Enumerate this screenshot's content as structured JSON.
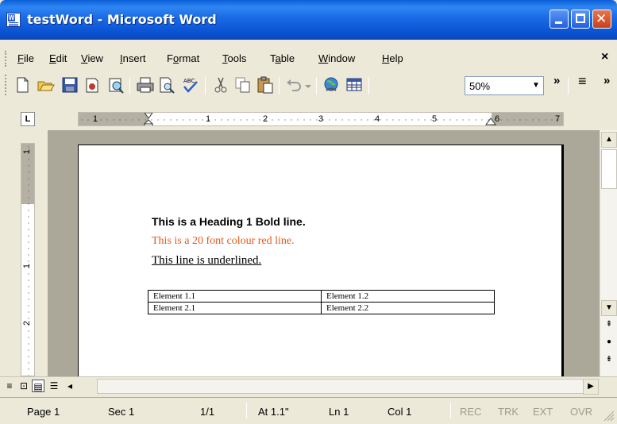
{
  "window": {
    "title": "testWord - Microsoft Word",
    "title_bar_color": "#0b54d3",
    "controls": [
      "minimize-icon",
      "maximize-icon",
      "close-icon"
    ],
    "close_glyph": "✕"
  },
  "menu": {
    "items": [
      {
        "label": "File",
        "accel": "F"
      },
      {
        "label": "Edit",
        "accel": "E"
      },
      {
        "label": "View",
        "accel": "V"
      },
      {
        "label": "Insert",
        "accel": "I"
      },
      {
        "label": "Format",
        "accel": "o"
      },
      {
        "label": "Tools",
        "accel": "T"
      },
      {
        "label": "Table",
        "accel": "a"
      },
      {
        "label": "Window",
        "accel": "W"
      },
      {
        "label": "Help",
        "accel": "H"
      }
    ],
    "close_doc_glyph": "×"
  },
  "toolbar": {
    "icons": [
      "new-document-icon",
      "open-folder-icon",
      "save-icon",
      "permission-icon",
      "research-icon",
      "print-icon",
      "print-preview-icon",
      "spelling-icon",
      "cut-icon",
      "copy-icon",
      "paste-icon",
      "undo-icon",
      "insert-hyperlink-icon",
      "table-icon"
    ],
    "zoom_value": "50%",
    "overflow_glyph": "»",
    "align_glyph": "≡"
  },
  "ruler": {
    "tab_selector": "L",
    "numbers": [
      "1",
      "1",
      "2",
      "3",
      "4",
      "5",
      "6",
      "7"
    ],
    "vertical_numbers": [
      "1",
      "1",
      "2"
    ]
  },
  "document": {
    "heading": "This is a Heading 1 Bold line.",
    "red_line": "This is a 20 font colour red line.",
    "underline_line": "This line is underlined.",
    "red_color": "#e0581a",
    "table": [
      [
        "Element 1.1",
        "Element 1.2"
      ],
      [
        "Element 2.1",
        "Element 2.2"
      ]
    ]
  },
  "status": {
    "page": "Page 1",
    "section": "Sec 1",
    "pages": "1/1",
    "at": "At 1.1\"",
    "line": "Ln 1",
    "col": "Col 1",
    "rec": "REC",
    "trk": "TRK",
    "ext": "EXT",
    "ovr": "OVR"
  }
}
